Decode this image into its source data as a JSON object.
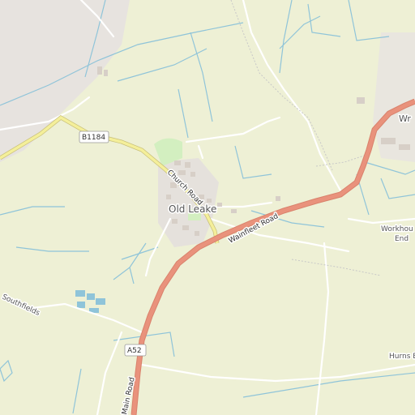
{
  "map": {
    "colors": {
      "farmland": "#eef0d5",
      "builtup": "#e7e3df",
      "water": "#8fc4d9",
      "a_road": "#e9927c",
      "b_road": "#f4ef9a",
      "minor_road": "#ffffff",
      "park": "#d3efc0",
      "building": "#d7cfc7"
    },
    "places": {
      "village": "Old Leake",
      "workhouse_end_1": "Workhou",
      "workhouse_end_2": "End",
      "southfields": "Southfields",
      "wrangle": "Wr",
      "hurns_end": "Hurns E"
    },
    "roads": {
      "church_road": "Church Road",
      "wainfleet_road": "Wainfleet Road",
      "main_road": "Main Road"
    },
    "shields": {
      "b1184": "B1184",
      "a52": "A52"
    }
  }
}
